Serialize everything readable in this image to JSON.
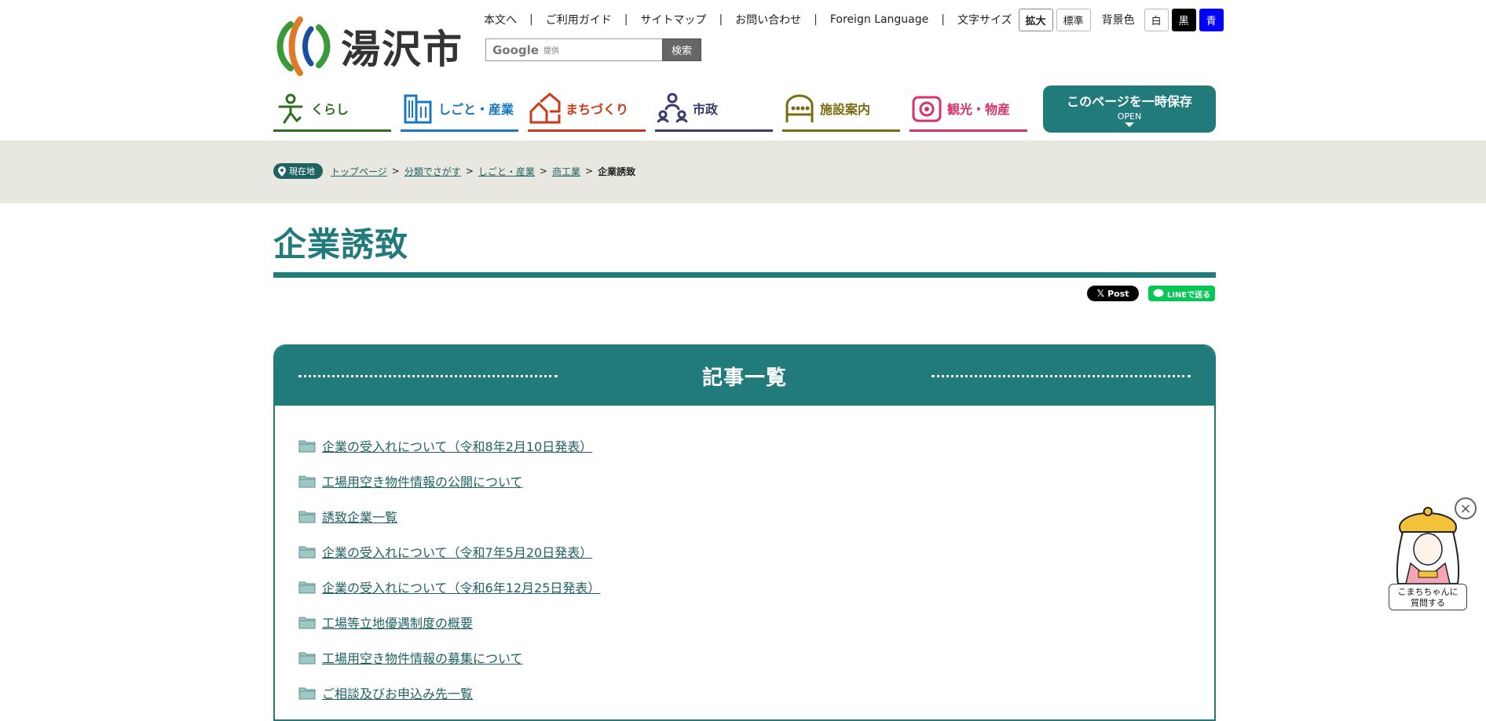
{
  "site": {
    "name": "湯沢市"
  },
  "util_links": [
    "本文へ",
    "ご利用ガイド",
    "サイトマップ",
    "お問い合わせ",
    "Foreign Language"
  ],
  "font_size": {
    "label": "文字サイズ",
    "large": "拡大",
    "normal": "標準"
  },
  "bg_color": {
    "label": "背景色",
    "white": "白",
    "black": "黒",
    "blue": "青"
  },
  "search": {
    "provider": "Google",
    "provided": "提供",
    "button": "検索"
  },
  "nav": [
    {
      "label": "くらし",
      "color": "#2e6e1f"
    },
    {
      "label": "しごと・産業",
      "color": "#1a78c2"
    },
    {
      "label": "まちづくり",
      "color": "#cc3a1a"
    },
    {
      "label": "市政",
      "color": "#3a3a6e"
    },
    {
      "label": "施設案内",
      "color": "#7a6a10"
    },
    {
      "label": "観光・物産",
      "color": "#d6336c"
    }
  ],
  "save_page": {
    "title": "このページを一時保存",
    "sub": "OPEN"
  },
  "breadcrumb": {
    "here": "現在地",
    "links": [
      "トップページ",
      "分類でさがす",
      "しごと・産業",
      "商工業"
    ],
    "current": "企業誘致"
  },
  "page_title": "企業誘致",
  "share": {
    "x": "Post",
    "line": "LINEで送る"
  },
  "articles": {
    "title": "記事一覧",
    "items": [
      "企業の受入れについて（令和8年2月10日発表）",
      "工場用空き物件情報の公開について",
      "誘致企業一覧",
      "企業の受入れについて（令和7年5月20日発表）",
      "企業の受入れについて（令和6年12月25日発表）",
      "工場等立地優遇制度の概要",
      "工場用空き物件情報の募集について",
      "ご相談及びお申込み先一覧"
    ]
  },
  "mascot": {
    "line1": "こまちちゃんに",
    "line2": "質問する"
  },
  "colors": {
    "accent": "#217b7b",
    "band": "#e8e8e0"
  }
}
